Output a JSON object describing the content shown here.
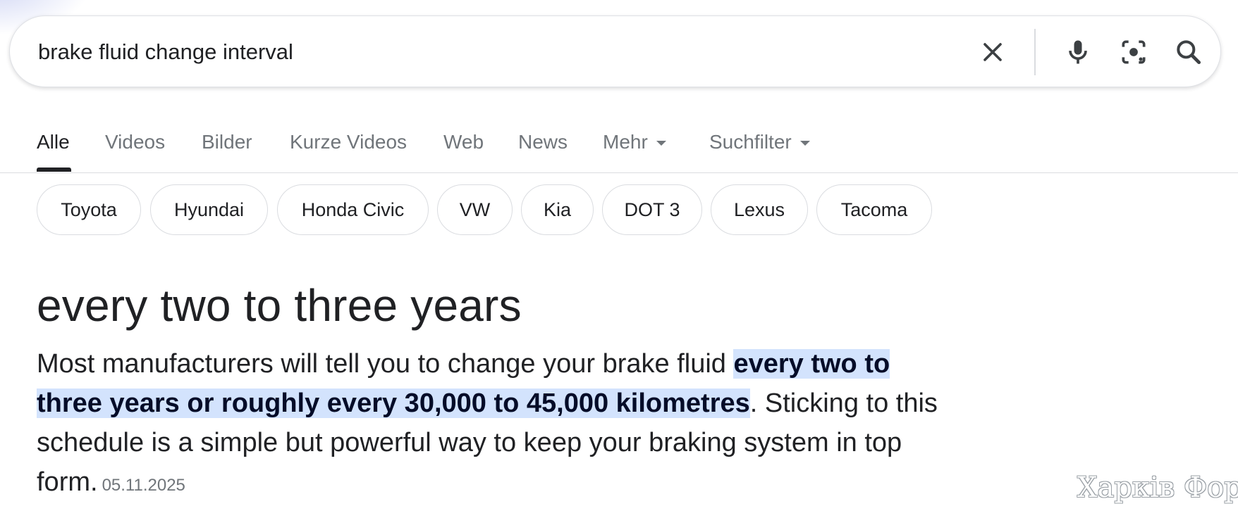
{
  "search": {
    "query": "brake fluid change interval",
    "icons": [
      "close-icon",
      "microphone-icon",
      "lens-camera-icon",
      "search-icon"
    ]
  },
  "tabs": [
    {
      "label": "Alle",
      "active": true
    },
    {
      "label": "Videos"
    },
    {
      "label": "Bilder"
    },
    {
      "label": "Kurze Videos"
    },
    {
      "label": "Web"
    },
    {
      "label": "News"
    },
    {
      "label": "Mehr"
    },
    {
      "label": "Suchfilter"
    }
  ],
  "chips": [
    "Toyota",
    "Hyundai",
    "Honda Civic",
    "VW",
    "Kia",
    "DOT 3",
    "Lexus",
    "Tacoma"
  ],
  "answer": {
    "title": "every two to three years",
    "text_before": "Most manufacturers will tell you to change your brake fluid ",
    "highlight": "every two to three years or roughly every 30,000 to 45,000 kilometres",
    "text_after": ". Sticking to this schedule is a simple but powerful way to keep your braking system in top form.",
    "date": "05.11.2025"
  },
  "watermark": "Харків Форум",
  "colors": {
    "highlight_bg": "#d3e3fd",
    "text": "#202124",
    "muted": "#70757a",
    "border": "#dadce0"
  }
}
